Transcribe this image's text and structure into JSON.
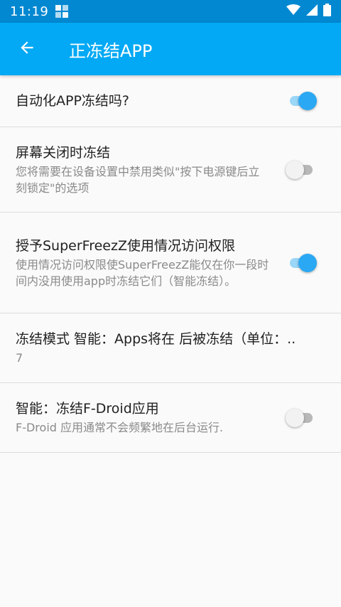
{
  "status_bar": {
    "time": "11:19",
    "icons": [
      "notification-icon",
      "wifi-icon",
      "signal-icon",
      "battery-icon"
    ]
  },
  "app_bar": {
    "title": "正冻结APP",
    "back_icon": "arrow-left-icon"
  },
  "colors": {
    "status_bar": "#0288d1",
    "app_bar": "#03a9f4",
    "switch_on_thumb": "#2ba8f3",
    "switch_on_track": "#9ad6f7",
    "switch_off_thumb": "#f2f2f2",
    "switch_off_track": "#b8b8b8"
  },
  "preferences": [
    {
      "title": "自动化APP冻结吗?",
      "summary": "",
      "switch": true
    },
    {
      "title": "屏幕关闭时冻结",
      "summary": "您将需要在设备设置中禁用类似\"按下电源键后立刻锁定\"的选项",
      "switch": false
    },
    {
      "title": "授予SuperFreezZ使用情况访问权限",
      "summary": "使用情况访问权限使SuperFreezZ能仅在你一段时间内没用使用app时冻结它们（智能冻结）。",
      "switch": true
    },
    {
      "title": "冻结模式 智能：Apps将在 后被冻结（单位：..",
      "summary": "7"
    },
    {
      "title": "智能：冻结F-Droid应用",
      "summary": "F-Droid 应用通常不会频繁地在后台运行.",
      "switch": false
    }
  ]
}
